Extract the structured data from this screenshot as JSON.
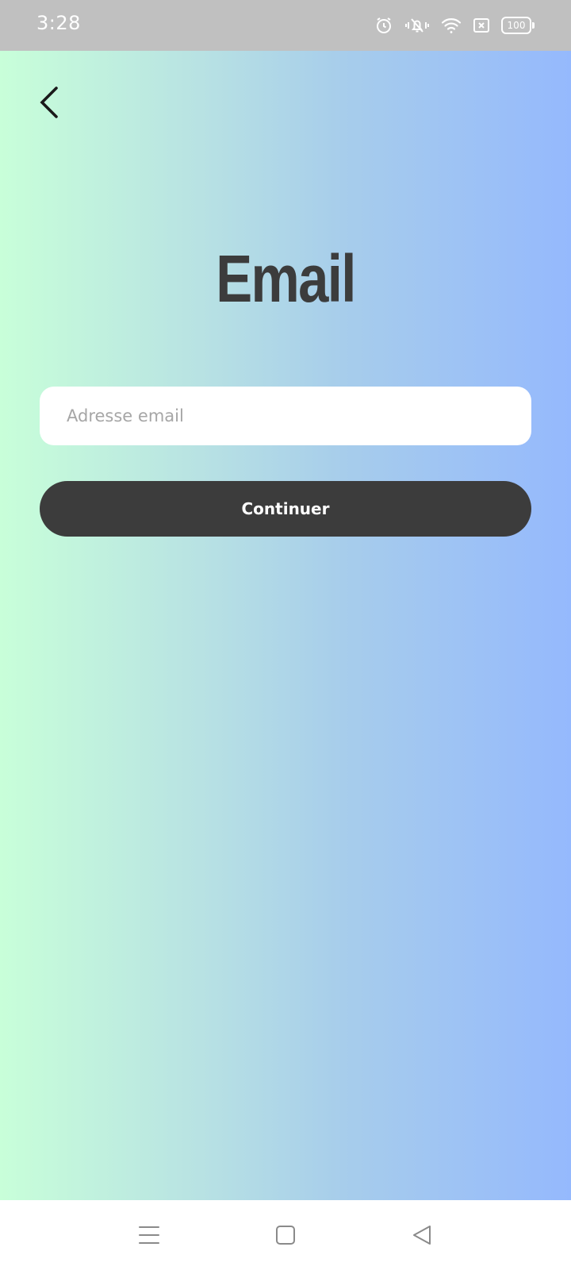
{
  "status_bar": {
    "time": "3:28",
    "battery_level": "100",
    "icons": [
      "alarm-icon",
      "mute-vibrate-icon",
      "wifi-icon",
      "sim-missing-icon",
      "battery-icon"
    ]
  },
  "header": {
    "back_icon": "chevron-left-icon"
  },
  "main": {
    "title": "Email",
    "email_field": {
      "value": "",
      "placeholder": "Adresse email"
    },
    "continue_label": "Continuer"
  },
  "nav_bar": {
    "icons": [
      "menu-icon",
      "home-icon",
      "back-icon"
    ]
  },
  "colors": {
    "gradient_start": "#c8ffd9",
    "gradient_end": "#95b9fd",
    "button_bg": "#3c3c3c",
    "title_color": "#3c3c3c",
    "status_bar_bg": "#c0c0c0"
  }
}
